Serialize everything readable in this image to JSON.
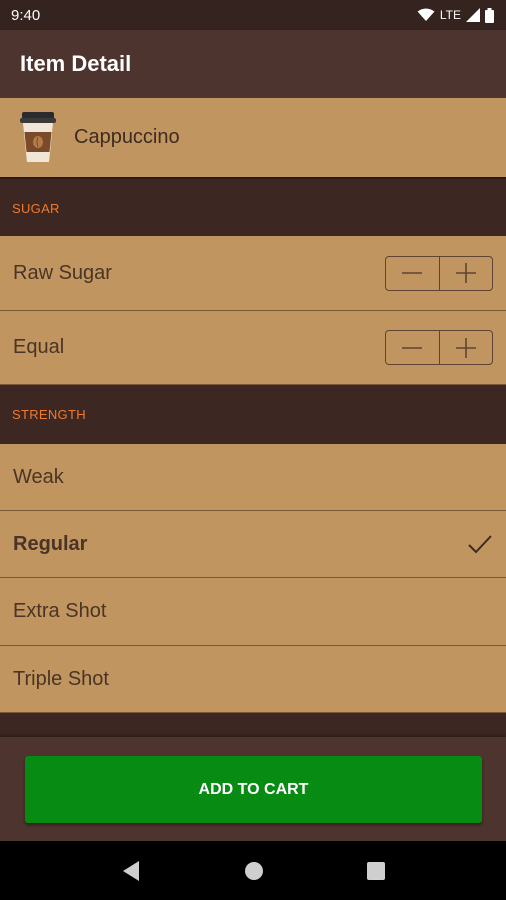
{
  "status_bar": {
    "time": "9:40",
    "network": "LTE"
  },
  "app_bar": {
    "title": "Item Detail"
  },
  "item": {
    "name": "Cappuccino",
    "icon": "coffee-cup-icon"
  },
  "sections": {
    "sugar": {
      "header": "SUGAR",
      "items": [
        {
          "label": "Raw Sugar"
        },
        {
          "label": "Equal"
        }
      ]
    },
    "strength": {
      "header": "STRENGTH",
      "selected": "Regular",
      "items": [
        {
          "label": "Weak"
        },
        {
          "label": "Regular"
        },
        {
          "label": "Extra Shot"
        },
        {
          "label": "Triple Shot"
        }
      ]
    }
  },
  "actions": {
    "add_to_cart": "ADD TO CART"
  },
  "colors": {
    "accent": "#ef7a2c",
    "row_background": "#c1955f",
    "app_bar": "#4e342e",
    "button": "#078b12"
  }
}
